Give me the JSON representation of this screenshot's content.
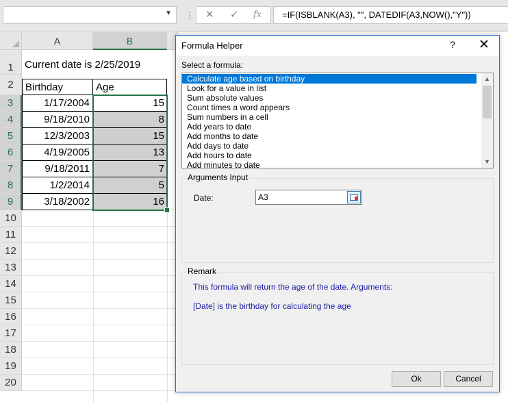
{
  "formula_bar": {
    "name_box": "",
    "cancel_glyph": "✕",
    "enter_glyph": "✓",
    "fx_glyph": "fx",
    "formula": "=IF(ISBLANK(A3), \"\", DATEDIF(A3,NOW(),\"Y\"))"
  },
  "sheet": {
    "columns": [
      "A",
      "B"
    ],
    "rows": [
      "1",
      "2",
      "3",
      "4",
      "5",
      "6",
      "7",
      "8",
      "9",
      "10",
      "11",
      "12",
      "13",
      "14",
      "15",
      "16",
      "17",
      "18",
      "19",
      "20"
    ],
    "a1": "Current date is 2/25/2019",
    "header_birthday": "Birthday",
    "header_age": "Age",
    "data": [
      {
        "birthday": "1/17/2004",
        "age": "15"
      },
      {
        "birthday": "9/18/2010",
        "age": "8"
      },
      {
        "birthday": "12/3/2003",
        "age": "15"
      },
      {
        "birthday": "4/19/2005",
        "age": "13"
      },
      {
        "birthday": "9/18/2011",
        "age": "7"
      },
      {
        "birthday": "1/2/2014",
        "age": "5"
      },
      {
        "birthday": "3/18/2002",
        "age": "16"
      }
    ]
  },
  "dialog": {
    "title": "Formula Helper",
    "help_glyph": "?",
    "close_glyph": "✕",
    "select_label": "Select a formula:",
    "formulas": [
      "Calculate age based on birthday",
      "Look for a value in list",
      "Sum absolute values",
      "Count times a word appears",
      "Sum numbers in a cell",
      "Add years to date",
      "Add months to date",
      "Add days to date",
      "Add hours to date",
      "Add minutes to date"
    ],
    "selected_formula": 0,
    "arguments_label": "Arguments Input",
    "date_label": "Date:",
    "date_value": "A3",
    "remark_label": "Remark",
    "remark_line1": "This formula will return the age of the date. Arguments:",
    "remark_line2": "[Date] is the birthday for calculating the age",
    "ok_label": "Ok",
    "cancel_label": "Cancel"
  },
  "colors": {
    "excel_green": "#217346",
    "selection_blue": "#0078d7",
    "remark_text": "#1a1aa6"
  },
  "icons": [
    "dropdown-arrow-icon",
    "cancel-icon",
    "enter-icon",
    "function-icon",
    "help-icon",
    "close-icon",
    "range-select-icon",
    "scroll-up-icon",
    "scroll-down-icon"
  ]
}
